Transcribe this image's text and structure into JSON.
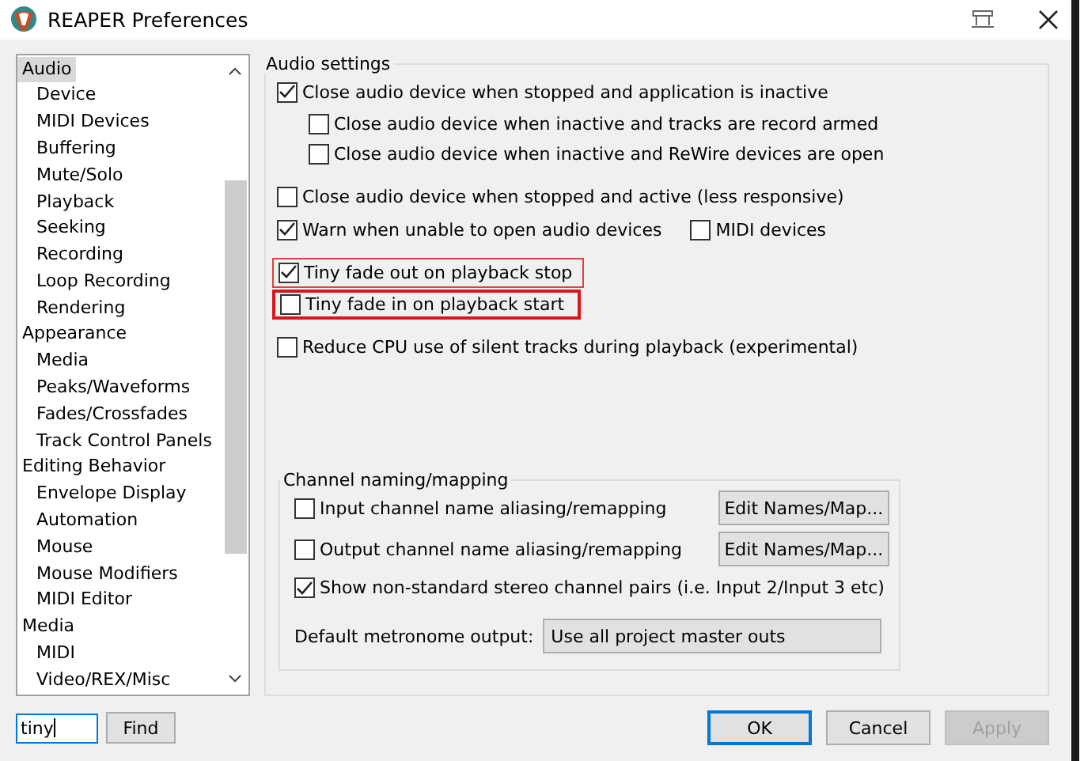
{
  "window": {
    "title": "REAPER Preferences"
  },
  "sidebar": {
    "items": [
      {
        "label": "Audio",
        "selected": true,
        "children": [
          {
            "label": "Device",
            "selected": false
          },
          {
            "label": "MIDI Devices",
            "selected": false
          },
          {
            "label": "Buffering",
            "selected": false
          },
          {
            "label": "Mute/Solo",
            "selected": false
          },
          {
            "label": "Playback",
            "selected": false
          },
          {
            "label": "Seeking",
            "selected": false
          },
          {
            "label": "Recording",
            "selected": false
          },
          {
            "label": "Loop Recording",
            "selected": false
          },
          {
            "label": "Rendering",
            "selected": false
          }
        ]
      },
      {
        "label": "Appearance",
        "selected": false,
        "children": [
          {
            "label": "Media",
            "selected": false
          },
          {
            "label": "Peaks/Waveforms",
            "selected": false
          },
          {
            "label": "Fades/Crossfades",
            "selected": false
          },
          {
            "label": "Track Control Panels",
            "selected": false
          }
        ]
      },
      {
        "label": "Editing Behavior",
        "selected": false,
        "children": [
          {
            "label": "Envelope Display",
            "selected": false
          },
          {
            "label": "Automation",
            "selected": false
          },
          {
            "label": "Mouse",
            "selected": false
          },
          {
            "label": "Mouse Modifiers",
            "selected": false
          },
          {
            "label": "MIDI Editor",
            "selected": false
          }
        ]
      },
      {
        "label": "Media",
        "selected": false,
        "children": [
          {
            "label": "MIDI",
            "selected": false
          },
          {
            "label": "Video/REX/Misc",
            "selected": false
          }
        ]
      }
    ]
  },
  "search": {
    "value": "tiny",
    "button": "Find"
  },
  "audio_settings": {
    "title": "Audio settings",
    "groups": [
      [
        {
          "label": "Close audio device when stopped and application is inactive",
          "checked": true,
          "children": [
            {
              "label": "Close audio device when inactive and tracks are record armed",
              "checked": false
            },
            {
              "label": "Close audio device when inactive and ReWire devices are open",
              "checked": false
            }
          ]
        }
      ],
      [
        {
          "label": "Close audio device when stopped and active (less responsive)",
          "checked": false
        },
        {
          "label": "Warn when unable to open audio devices",
          "checked": true,
          "side": {
            "label": "MIDI devices",
            "checked": false
          }
        }
      ],
      [
        {
          "label": "Tiny fade out on playback stop",
          "checked": true,
          "highlighted": true,
          "emphasized": false
        },
        {
          "label": "Tiny fade in on playback start",
          "checked": false,
          "highlighted": true,
          "emphasized": true
        }
      ],
      [
        {
          "label": "Reduce CPU use of silent tracks during playback (experimental)",
          "checked": false
        }
      ]
    ]
  },
  "channel_mapping": {
    "title": "Channel naming/mapping",
    "rows": [
      {
        "label": "Input channel name aliasing/remapping",
        "checked": false,
        "button": "Edit Names/Map..."
      },
      {
        "label": "Output channel name aliasing/remapping",
        "checked": false,
        "button": "Edit Names/Map..."
      },
      {
        "label": "Show non-standard stereo channel pairs (i.e. Input 2/Input 3 etc)",
        "checked": true
      }
    ],
    "metronome": {
      "label": "Default metronome output:",
      "value": "Use all project master outs"
    }
  },
  "buttons": [
    {
      "label": "OK",
      "kind": "default"
    },
    {
      "label": "Cancel",
      "kind": "normal"
    },
    {
      "label": "Apply",
      "kind": "disabled"
    }
  ]
}
